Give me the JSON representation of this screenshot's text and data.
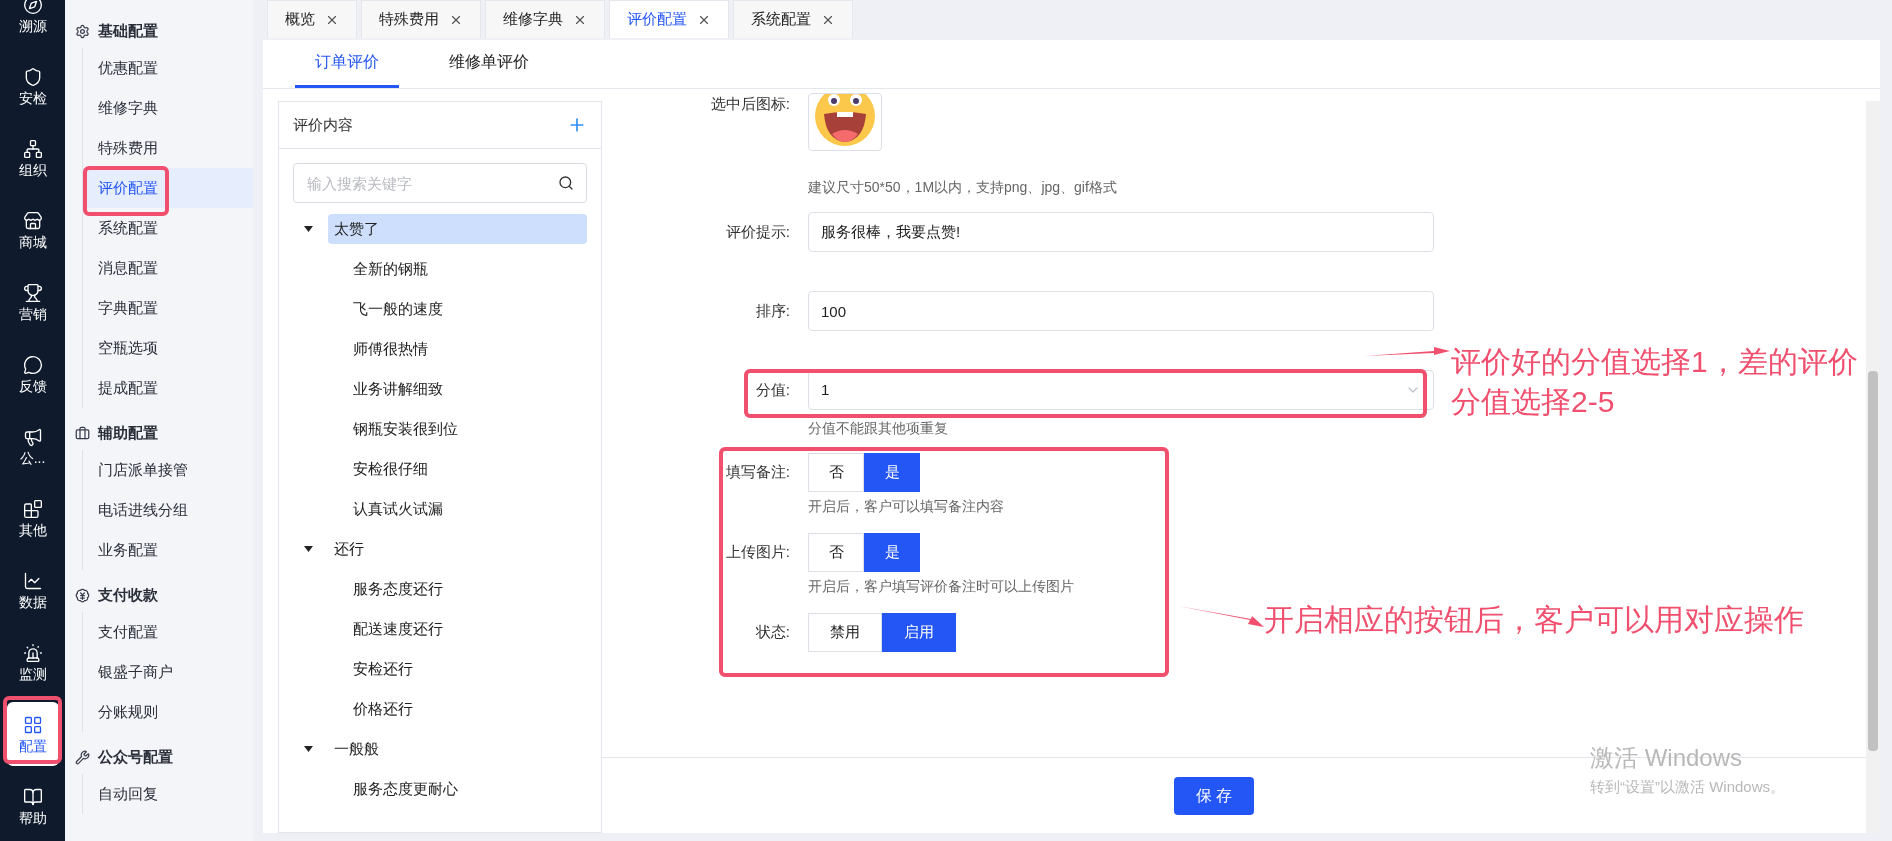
{
  "rail": [
    {
      "label": "溯源",
      "selected": false
    },
    {
      "label": "安检",
      "selected": false
    },
    {
      "label": "组织",
      "selected": false
    },
    {
      "label": "商城",
      "selected": false
    },
    {
      "label": "营销",
      "selected": false
    },
    {
      "label": "反馈",
      "selected": false
    },
    {
      "label": "公...",
      "selected": false
    },
    {
      "label": "其他",
      "selected": false
    },
    {
      "label": "数据",
      "selected": false
    },
    {
      "label": "监测",
      "selected": false
    },
    {
      "label": "配置",
      "selected": true
    },
    {
      "label": "帮助",
      "selected": false
    }
  ],
  "menu": [
    {
      "title": "基础配置",
      "items": [
        {
          "label": "优惠配置",
          "selected": false
        },
        {
          "label": "维修字典",
          "selected": false
        },
        {
          "label": "特殊费用",
          "selected": false
        },
        {
          "label": "评价配置",
          "selected": true
        },
        {
          "label": "系统配置",
          "selected": false
        },
        {
          "label": "消息配置",
          "selected": false
        },
        {
          "label": "字典配置",
          "selected": false
        },
        {
          "label": "空瓶选项",
          "selected": false
        },
        {
          "label": "提成配置",
          "selected": false
        }
      ]
    },
    {
      "title": "辅助配置",
      "items": [
        {
          "label": "门店派单接管",
          "selected": false
        },
        {
          "label": "电话进线分组",
          "selected": false
        },
        {
          "label": "业务配置",
          "selected": false
        }
      ]
    },
    {
      "title": "支付收款",
      "items": [
        {
          "label": "支付配置",
          "selected": false
        },
        {
          "label": "银盛子商户",
          "selected": false
        },
        {
          "label": "分账规则",
          "selected": false
        }
      ]
    },
    {
      "title": "公众号配置",
      "items": [
        {
          "label": "自动回复",
          "selected": false
        }
      ]
    }
  ],
  "tabs": [
    {
      "label": "概览",
      "selected": false
    },
    {
      "label": "特殊费用",
      "selected": false
    },
    {
      "label": "维修字典",
      "selected": false
    },
    {
      "label": "评价配置",
      "selected": true
    },
    {
      "label": "系统配置",
      "selected": false
    }
  ],
  "subtabs": [
    {
      "label": "订单评价",
      "selected": true
    },
    {
      "label": "维修单评价",
      "selected": false
    }
  ],
  "tree": {
    "title": "评价内容",
    "search_placeholder": "输入搜索关键字",
    "nodes": [
      {
        "label": "太赞了",
        "expanded": true,
        "selected": true,
        "children": [
          {
            "label": "全新的钢瓶"
          },
          {
            "label": "飞一般的速度"
          },
          {
            "label": "师傅很热情"
          },
          {
            "label": "业务讲解细致"
          },
          {
            "label": "钢瓶安装很到位"
          },
          {
            "label": "安检很仔细"
          },
          {
            "label": "认真试火试漏"
          }
        ]
      },
      {
        "label": "还行",
        "expanded": true,
        "selected": false,
        "children": [
          {
            "label": "服务态度还行"
          },
          {
            "label": "配送速度还行"
          },
          {
            "label": "安检还行"
          },
          {
            "label": "价格还行"
          }
        ]
      },
      {
        "label": "一般般",
        "expanded": true,
        "selected": false,
        "children": [
          {
            "label": "服务态度更耐心"
          }
        ]
      }
    ]
  },
  "form": {
    "icon_label": "选中后图标:",
    "icon_hint": "建议尺寸50*50，1M以内，支持png、jpg、gif格式",
    "fields": [
      {
        "label": "评价提示:",
        "value": "服务很棒，我要点赞!"
      },
      {
        "label": "排序:",
        "value": "100"
      }
    ],
    "score": {
      "label": "分值:",
      "value": "1",
      "hint": "分值不能跟其他项重复"
    },
    "toggles": [
      {
        "label": "填写备注:",
        "hint": "开启后，客户可以填写备注内容",
        "options": [
          {
            "label": "否",
            "selected": false
          },
          {
            "label": "是",
            "selected": true
          }
        ]
      },
      {
        "label": "上传图片:",
        "hint": "开启后，客户填写评价备注时可以上传图片",
        "options": [
          {
            "label": "否",
            "selected": false
          },
          {
            "label": "是",
            "selected": true
          }
        ]
      },
      {
        "label": "状态:",
        "options": [
          {
            "label": "禁用",
            "selected": false
          },
          {
            "label": "启用",
            "selected": true
          }
        ]
      }
    ],
    "save": "保 存"
  },
  "annotations": [
    "评价好的分值选择1，差的评价分值选择2-5",
    "开启相应的按钮后，客户可以用对应操作"
  ],
  "os_notice": {
    "title": "激活 Windows",
    "subtitle": "转到“设置”以激活 Windows。"
  }
}
